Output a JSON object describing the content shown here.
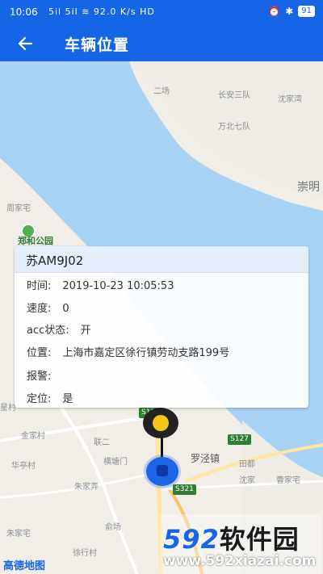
{
  "status_bar": {
    "time": "10:06",
    "signal": "5il 5il ≋ 92.0 K/s HD",
    "battery": "91"
  },
  "header": {
    "title": "车辆位置",
    "back_icon": "arrow-left-icon"
  },
  "map": {
    "places": {
      "erchang": "二场",
      "changan": "长安三队",
      "shenjia": "沈家湾",
      "wanbei": "万北七队",
      "chongming": "崇明",
      "zhoujiazhai": "周家宅",
      "park": "郑和公园",
      "jinjiacun": "金家村",
      "lianer": "联二",
      "luojing": "罗泾镇",
      "tiandu": "田都",
      "huatingcun": "华亭村",
      "hengjiamen": "横塘门",
      "zhujiaqiao": "朱家弄",
      "shenjia2": "沈家",
      "caojiazhai": "曹家宅",
      "zhujiazhai": "朱家宅",
      "yuchang": "俞场",
      "xucun": "徐行村",
      "xingcun": "星村"
    },
    "roads": {
      "s127": "S127",
      "s321": "S321",
      "s120": "S120"
    },
    "provider": "高德地图"
  },
  "info_window": {
    "plate": "苏AM9J02",
    "time_label": "时间:",
    "time_value": "2019-10-23 10:05:53",
    "speed_label": "速度:",
    "speed_value": "0",
    "acc_label": "acc状态:",
    "acc_value": "开",
    "location_label": "位置:",
    "location_value": "上海市嘉定区徐行镇劳动支路199号",
    "alarm_label": "报警:",
    "alarm_value": "",
    "positioning_label": "定位:",
    "positioning_value": "是"
  },
  "watermark": {
    "brand_num": "592",
    "brand_text": "软件园",
    "url": "www.592xiazai.com"
  },
  "colors": {
    "primary": "#1565e6",
    "water": "#a9d3f5",
    "land": "#f1eee8",
    "marker_yellow": "#f5c518",
    "vehicle_blue": "#1e64e6"
  }
}
